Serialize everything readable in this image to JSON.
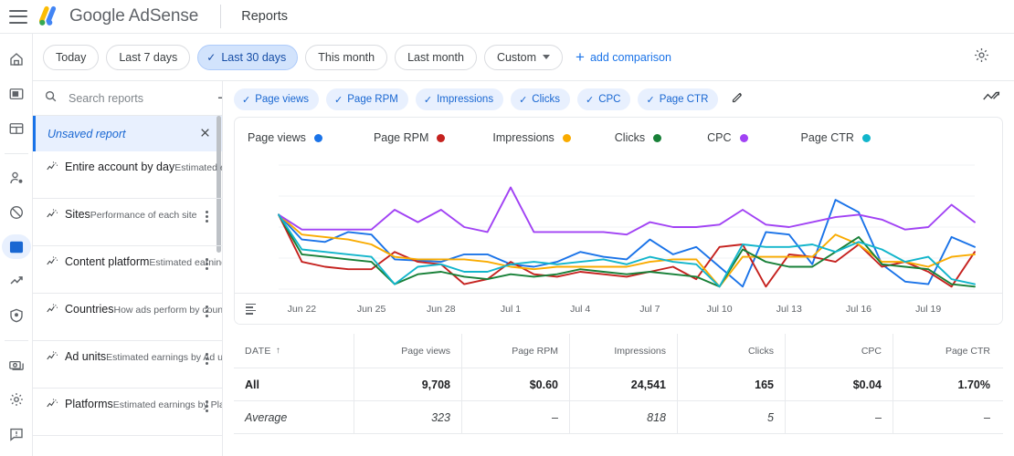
{
  "header": {
    "menu_icon": "hamburger-icon",
    "logo_icon": "google-adsense-logo",
    "brand": "Google AdSense",
    "section": "Reports"
  },
  "rail": {
    "items": [
      {
        "icon": "home-icon",
        "name": "home",
        "active": false
      },
      {
        "icon": "ads-icon",
        "name": "ads",
        "active": false
      },
      {
        "icon": "layout-icon",
        "name": "sites-layout",
        "active": false
      },
      {
        "icon": "person-add-icon",
        "name": "privacy-messaging",
        "active": false
      },
      {
        "icon": "block-icon",
        "name": "blocking-controls",
        "active": false
      },
      {
        "icon": "bar-chart-icon",
        "name": "reports",
        "active": true
      },
      {
        "icon": "trending-up-icon",
        "name": "optimization",
        "active": false
      },
      {
        "icon": "shield-icon",
        "name": "brand-safety",
        "active": false
      },
      {
        "icon": "payments-icon",
        "name": "payments",
        "active": false
      },
      {
        "icon": "gear-icon",
        "name": "account-settings",
        "active": false
      },
      {
        "icon": "feedback-icon",
        "name": "feedback",
        "active": false
      }
    ]
  },
  "date_filter": {
    "options": [
      {
        "label": "Today",
        "selected": false
      },
      {
        "label": "Last 7 days",
        "selected": false
      },
      {
        "label": "Last 30 days",
        "selected": true
      },
      {
        "label": "This month",
        "selected": false
      },
      {
        "label": "Last month",
        "selected": false
      },
      {
        "label": "Custom",
        "selected": false,
        "caret": true
      }
    ],
    "add_comparison": "add comparison",
    "settings_icon": "gear-icon"
  },
  "sidebar": {
    "search": {
      "placeholder": "Search reports",
      "value": "",
      "icon": "search-icon"
    },
    "add_icon": "plus-icon",
    "unsaved": {
      "label": "Unsaved report",
      "close_icon": "close-icon"
    },
    "reports": [
      {
        "title": "Entire account by day",
        "subtitle": "Estimated earnings by Date",
        "icon": "report-sparkline-icon",
        "kebab": false
      },
      {
        "title": "Sites",
        "subtitle": "Performance of each site",
        "icon": "report-sparkline-icon",
        "kebab": true
      },
      {
        "title": "Content platform",
        "subtitle": "Estimated earnings by Platform…",
        "icon": "report-sparkline-icon",
        "kebab": true
      },
      {
        "title": "Countries",
        "subtitle": "How ads perform by country",
        "icon": "report-sparkline-icon",
        "kebab": true
      },
      {
        "title": "Ad units",
        "subtitle": "Estimated earnings by Ad unit",
        "icon": "report-sparkline-icon",
        "kebab": true
      },
      {
        "title": "Platforms",
        "subtitle": "Estimated earnings by Platform",
        "icon": "report-sparkline-icon",
        "kebab": true
      }
    ]
  },
  "metric_chips": [
    {
      "label": "Page views"
    },
    {
      "label": "Page RPM"
    },
    {
      "label": "Impressions"
    },
    {
      "label": "Clicks"
    },
    {
      "label": "CPC"
    },
    {
      "label": "Page CTR"
    }
  ],
  "edit_icon": "pencil-icon",
  "chart_toggle_icon": "sparkline-toggle-icon",
  "chart_data": {
    "type": "line",
    "title": "",
    "xlabel": "",
    "ylabel": "",
    "grid": true,
    "legend_position": "top-left",
    "tick_labels": [
      "Jun 22",
      "Jun 25",
      "Jun 28",
      "Jul 1",
      "Jul 4",
      "Jul 7",
      "Jul 10",
      "Jul 13",
      "Jul 16",
      "Jul 19"
    ],
    "x": [
      "Jun 21",
      "Jun 22",
      "Jun 23",
      "Jun 24",
      "Jun 25",
      "Jun 26",
      "Jun 27",
      "Jun 28",
      "Jun 29",
      "Jun 30",
      "Jul 1",
      "Jul 2",
      "Jul 3",
      "Jul 4",
      "Jul 5",
      "Jul 6",
      "Jul 7",
      "Jul 8",
      "Jul 9",
      "Jul 10",
      "Jul 11",
      "Jul 12",
      "Jul 13",
      "Jul 14",
      "Jul 15",
      "Jul 16",
      "Jul 17",
      "Jul 18",
      "Jul 19",
      "Jul 20"
    ],
    "ylim": [
      0,
      100
    ],
    "series": [
      {
        "name": "Page views",
        "color": "#1a73e8",
        "values": [
          60,
          40,
          38,
          46,
          44,
          24,
          23,
          22,
          28,
          28,
          20,
          18,
          22,
          30,
          26,
          24,
          40,
          28,
          34,
          18,
          2,
          46,
          44,
          20,
          72,
          62,
          20,
          6,
          4,
          42,
          34
        ]
      },
      {
        "name": "Page RPM",
        "color": "#c5221f",
        "values": [
          60,
          22,
          18,
          16,
          16,
          30,
          22,
          20,
          4,
          8,
          22,
          12,
          10,
          14,
          12,
          10,
          14,
          18,
          8,
          34,
          36,
          2,
          28,
          26,
          22,
          36,
          18,
          22,
          14,
          2,
          30
        ]
      },
      {
        "name": "Impressions",
        "color": "#f9ab00",
        "values": [
          60,
          44,
          42,
          40,
          36,
          26,
          24,
          24,
          24,
          22,
          18,
          16,
          18,
          18,
          18,
          18,
          22,
          24,
          24,
          2,
          26,
          26,
          26,
          26,
          44,
          36,
          22,
          22,
          18,
          26,
          28
        ]
      },
      {
        "name": "Clicks",
        "color": "#188038",
        "values": [
          60,
          28,
          26,
          24,
          22,
          4,
          12,
          14,
          10,
          8,
          12,
          10,
          12,
          16,
          14,
          12,
          14,
          12,
          10,
          2,
          32,
          22,
          18,
          18,
          30,
          42,
          20,
          18,
          16,
          4,
          2
        ]
      },
      {
        "name": "CPC",
        "color": "#a142f4",
        "values": [
          60,
          48,
          48,
          48,
          48,
          64,
          54,
          64,
          50,
          46,
          82,
          46,
          46,
          46,
          46,
          44,
          54,
          50,
          50,
          52,
          64,
          52,
          50,
          54,
          58,
          60,
          56,
          48,
          50,
          68,
          54
        ]
      },
      {
        "name": "Page CTR",
        "color": "#12b5cb",
        "values": [
          60,
          32,
          30,
          28,
          26,
          4,
          18,
          20,
          14,
          14,
          20,
          22,
          20,
          22,
          24,
          20,
          26,
          22,
          20,
          2,
          36,
          34,
          34,
          36,
          30,
          38,
          32,
          22,
          26,
          8,
          4
        ]
      }
    ]
  },
  "table": {
    "columns": [
      "DATE",
      "Page views",
      "Page RPM",
      "Impressions",
      "Clicks",
      "CPC",
      "Page CTR"
    ],
    "sort_column": "DATE",
    "sort_icon": "arrow-up-icon",
    "rows": [
      {
        "style": "total",
        "cells": [
          "All",
          "9,708",
          "$0.60",
          "24,541",
          "165",
          "$0.04",
          "1.70%"
        ]
      },
      {
        "style": "average",
        "cells": [
          "Average",
          "323",
          "–",
          "818",
          "5",
          "–",
          "–"
        ]
      }
    ]
  }
}
